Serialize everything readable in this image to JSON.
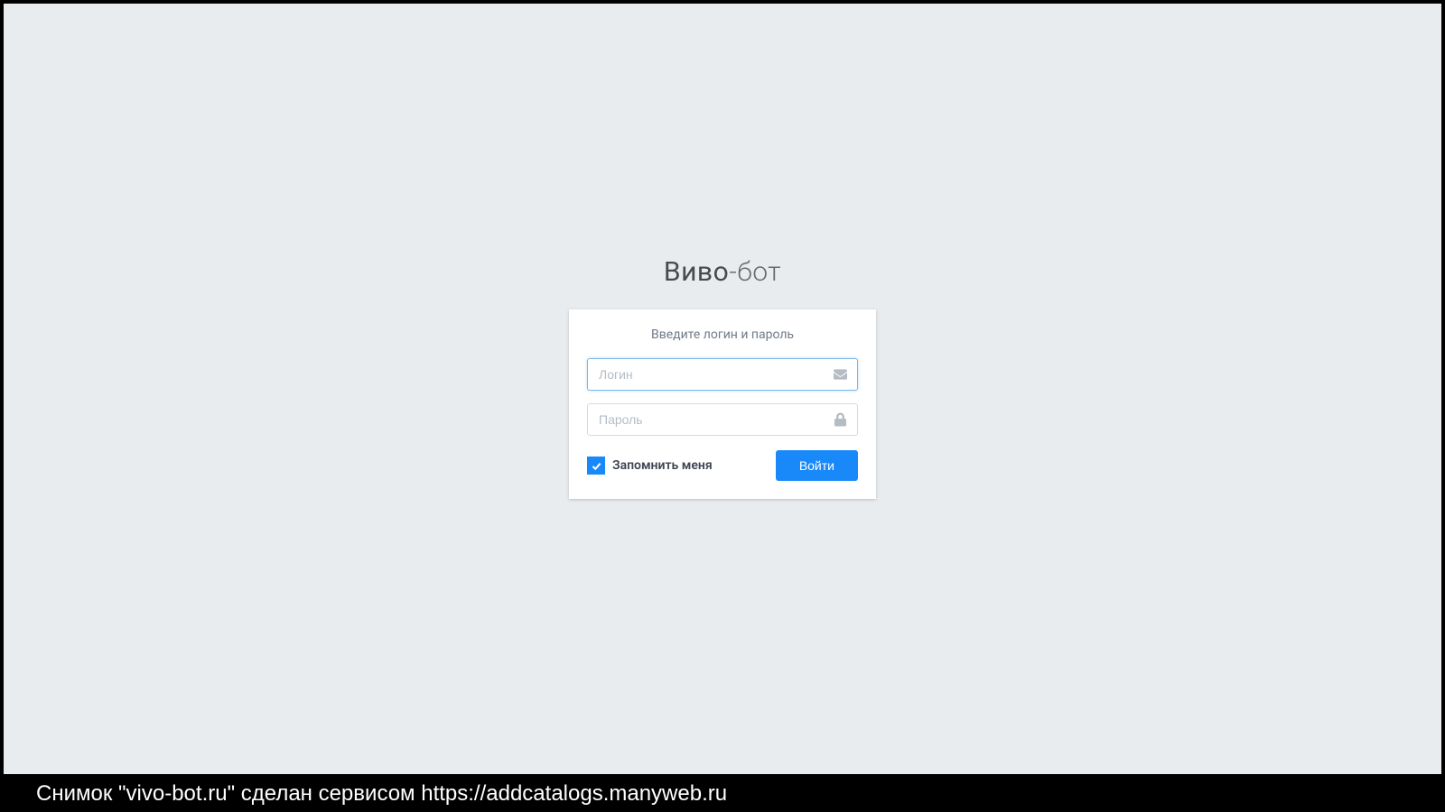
{
  "brand": {
    "bold": "Виво",
    "light": "-бот"
  },
  "form": {
    "instruction": "Введите логин и пароль",
    "login_placeholder": "Логин",
    "password_placeholder": "Пароль",
    "remember_label": "Запомнить меня",
    "remember_checked": true,
    "submit_label": "Войти"
  },
  "footer": {
    "caption": "Снимок \"vivo-bot.ru\" сделан сервисом https://addcatalogs.manyweb.ru"
  }
}
